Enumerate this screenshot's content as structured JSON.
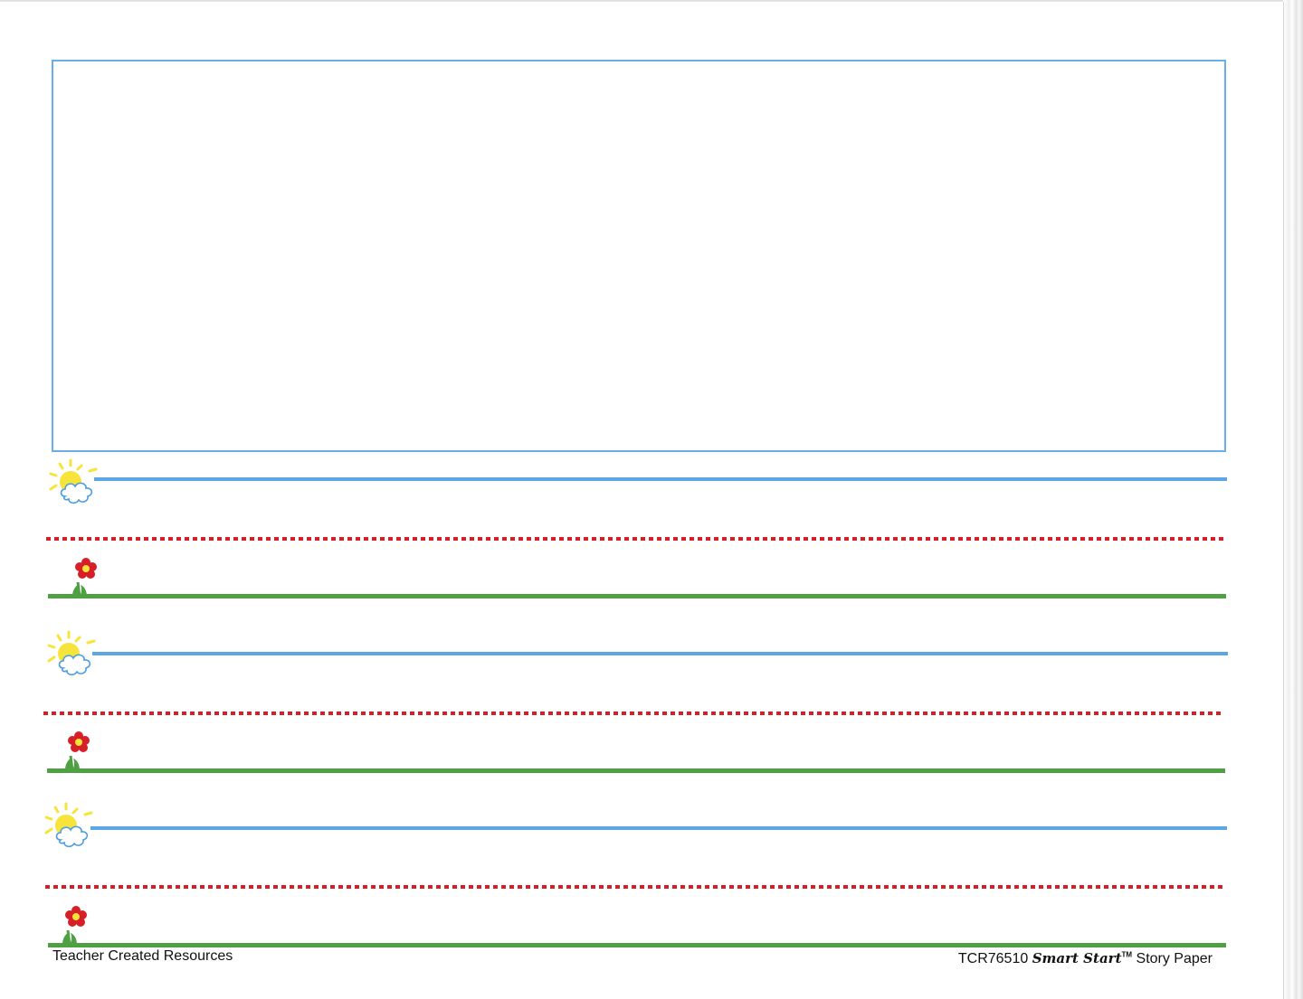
{
  "document": {
    "type": "story-paper",
    "colors": {
      "frame": "#6aaee6",
      "top_line": "#5ea6e3",
      "dotted_mid_line": "#d61f26",
      "base_line": "#4f9f43",
      "sun": "#f7e43a",
      "cloud_outline": "#4a9be0",
      "flower": "#d61f26",
      "grass": "#4f9f43"
    },
    "icons": {
      "top_line_icon": "sun-cloud-icon",
      "base_line_icon": "flower-icon"
    },
    "writing_rows": 3
  },
  "footer": {
    "publisher": "Teacher Created Resources",
    "product_code": "TCR76510",
    "brand": "Smart Start",
    "trademark": "TM",
    "product_name": "Story Paper"
  }
}
